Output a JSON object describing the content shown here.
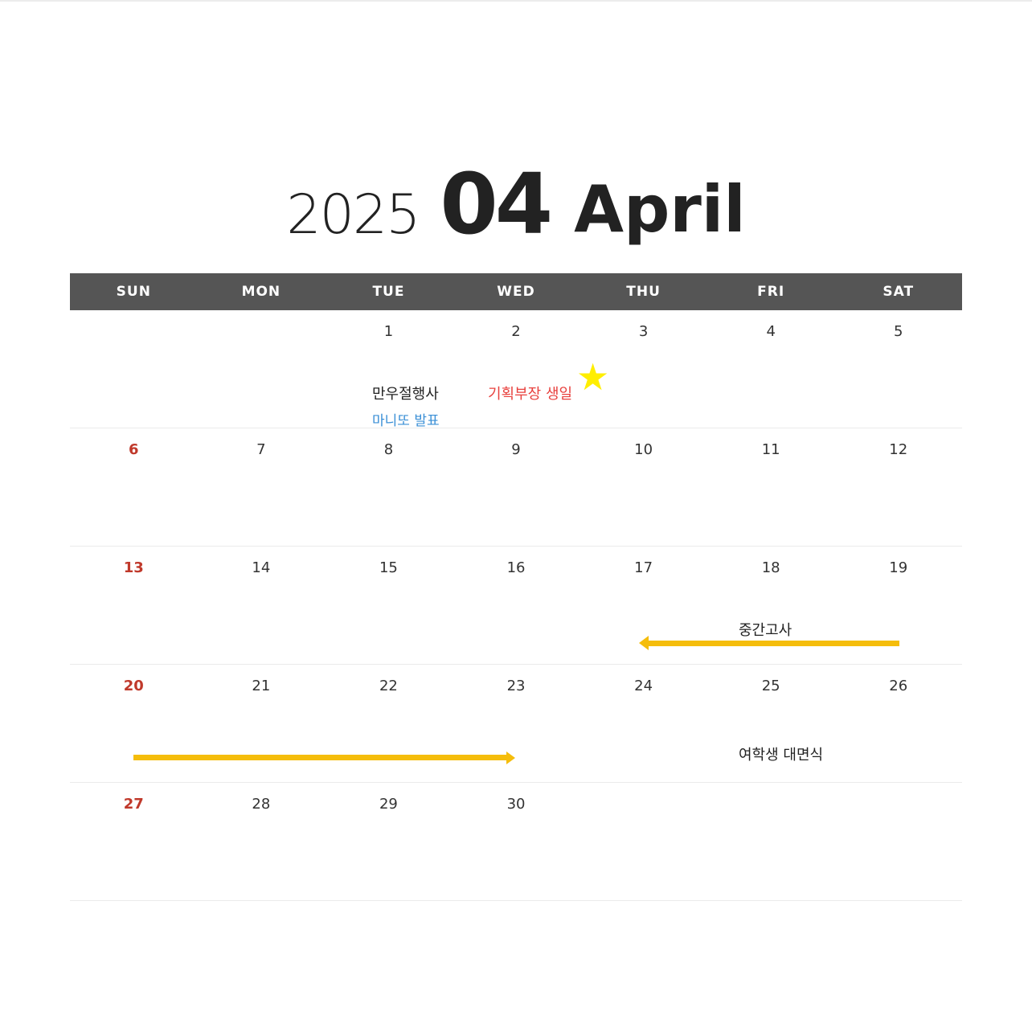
{
  "title": {
    "year": "2025",
    "month_number": "04",
    "month_name": "April"
  },
  "weekdays": [
    "SUN",
    "MON",
    "TUE",
    "WED",
    "THU",
    "FRI",
    "SAT"
  ],
  "weeks": [
    [
      "",
      "",
      "1",
      "2",
      "3",
      "4",
      "5"
    ],
    [
      "6",
      "7",
      "8",
      "9",
      "10",
      "11",
      "12"
    ],
    [
      "13",
      "14",
      "15",
      "16",
      "17",
      "18",
      "19"
    ],
    [
      "20",
      "21",
      "22",
      "23",
      "24",
      "25",
      "26"
    ],
    [
      "27",
      "28",
      "29",
      "30",
      "",
      "",
      ""
    ]
  ],
  "events": {
    "manwoo": "만우절행사",
    "manitto": "마니또 발표",
    "birthday": "기획부장 생일",
    "midterm": "중간고사",
    "meeting": "여학생 대면식"
  },
  "colors": {
    "header_bg": "#555555",
    "sunday": "#c0392b",
    "arrow": "#f5bd0b",
    "star": "#ffee00",
    "event_red": "#e8403d",
    "event_blue": "#3a8fd6"
  },
  "icons": {
    "birthday_marker": "star-icon",
    "midterm_span": "arrow-left-icon",
    "midterm_span_end": "arrow-right-icon"
  }
}
